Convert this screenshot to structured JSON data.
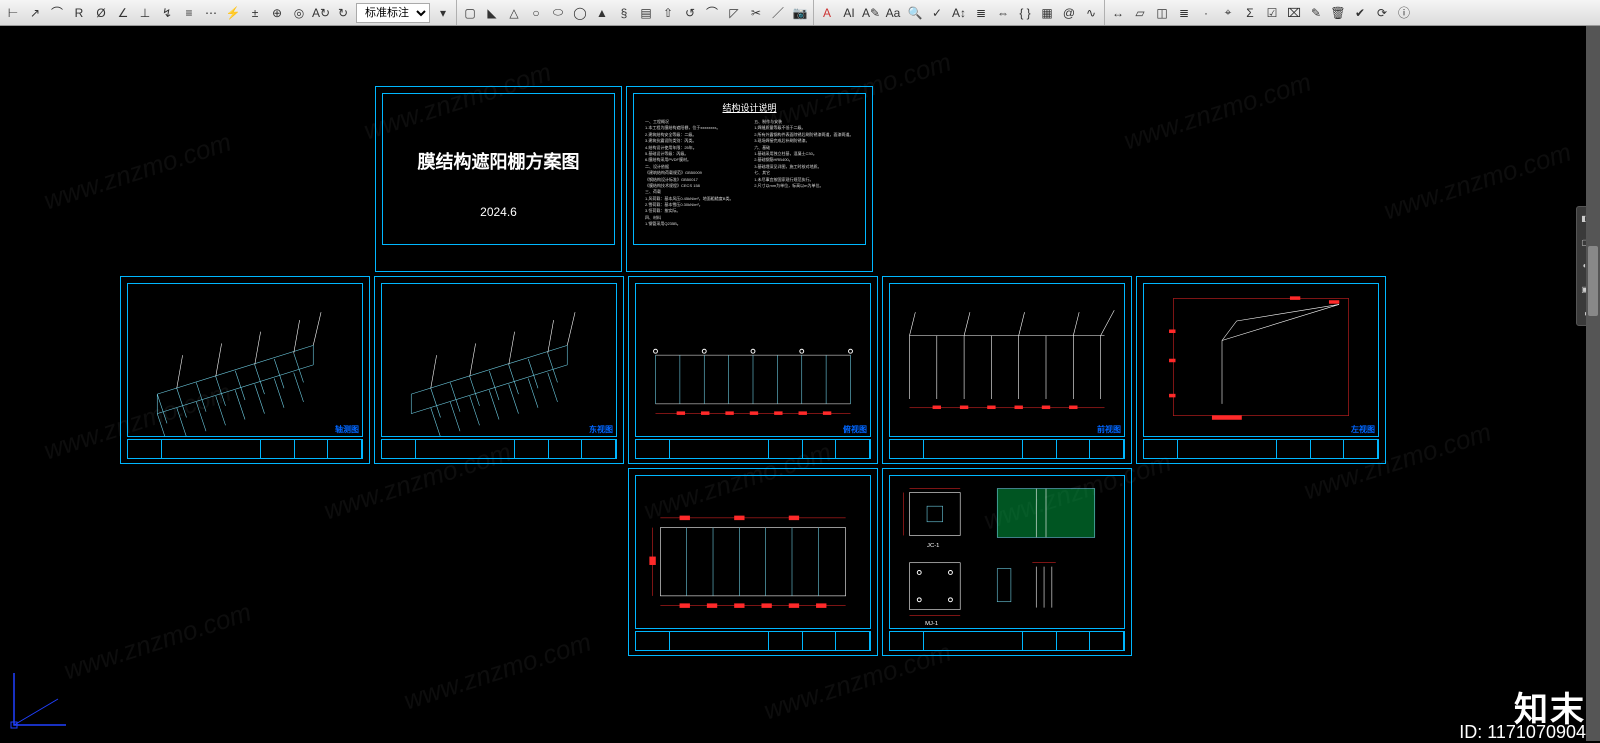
{
  "toolbar": {
    "dim_style": "标准标注",
    "groups": [
      [
        "linear-dim",
        "aligned-dim",
        "arc-dim",
        "radius-dim",
        "diameter-dim",
        "angular-dim",
        "ordinate-dim",
        "jogged-dim",
        "baseline-dim",
        "continue-dim",
        "quick-dim",
        "tolerance",
        "center-mark",
        "inspect-dim",
        "oblique-dim",
        "text-angle",
        "dim-update",
        "reassoc-dim"
      ],
      [
        "3d-box",
        "3d-wedge",
        "3d-cone",
        "3d-sphere",
        "3d-cylinder",
        "3d-torus",
        "3d-pyramid",
        "helix",
        "polysolid",
        "planar-surf",
        "extrude",
        "revolve",
        "fillet-edge",
        "chamfer-edge",
        "section",
        "slice"
      ],
      [
        "mtext",
        "dtext",
        "edit-text",
        "text-style",
        "find",
        "spell",
        "scale-text",
        "justify-text",
        "align-text",
        "space-text",
        "field",
        "table",
        "attribute"
      ],
      [
        "dist",
        "area",
        "region",
        "list",
        "id-point",
        "locate",
        "mass-prop",
        "qselect",
        "quick-calc",
        "match-prop",
        "purge",
        "audit",
        "recover",
        "status"
      ]
    ]
  },
  "sheets": {
    "title": {
      "heading": "膜结构遮阳棚方案图",
      "date": "2024.6"
    },
    "notes": {
      "heading": "结构设计说明",
      "lines_left": [
        "一、工程概况",
        "1.本工程为膜结构遮阳棚，位于xxxxxxxx。",
        "2.建筑结构安全等级：二级。",
        "3.建筑抗震设防类别：丙类。",
        "4.结构设计使用年限：25年。",
        "5.基础设计等级：丙级。",
        "6.膜结构采用PVDF膜材。",
        "二、设计依据",
        "《建筑结构荷载规范》GB50009",
        "《钢结构设计标准》GB50017",
        "《膜结构技术规程》CECS 158",
        "三、荷载",
        "1.风荷载：基本风压0.45kN/m²，地面粗糙度B类。",
        "2.雪荷载：基本雪压0.30kN/m²。",
        "3.恒荷载：按实际。",
        "四、材料",
        "1.钢管采用Q235B。"
      ],
      "lines_right": [
        "五、制作与安装",
        "1.焊缝质量等级不低于二级。",
        "2.所有外露钢构件表面除锈后刷防锈漆两道，面漆两道。",
        "3.现场焊接完成后补刷防锈漆。",
        "六、基础",
        "1.基础采用独立柱基，混凝土C30。",
        "2.基础钢筋HRB400。",
        "3.基础埋深见详图，施工时核对地质。",
        "七、其它",
        "1.未尽事宜按国家现行规范执行。",
        "2.尺寸以mm为单位，标高以m为单位。"
      ]
    },
    "row2": [
      {
        "label": "轴测图"
      },
      {
        "label": "东视图"
      },
      {
        "label": "俯视图"
      },
      {
        "label": "前视图"
      },
      {
        "label": "左视图"
      }
    ],
    "row3": [
      {
        "label": ""
      },
      {
        "label": ""
      }
    ]
  },
  "brand": {
    "logo": "知末",
    "id_label": "ID: 1171070904"
  },
  "watermark_text": "www.znzmo.com",
  "navcube": [
    "◧",
    "▢",
    "◐",
    "▣",
    "◑"
  ]
}
